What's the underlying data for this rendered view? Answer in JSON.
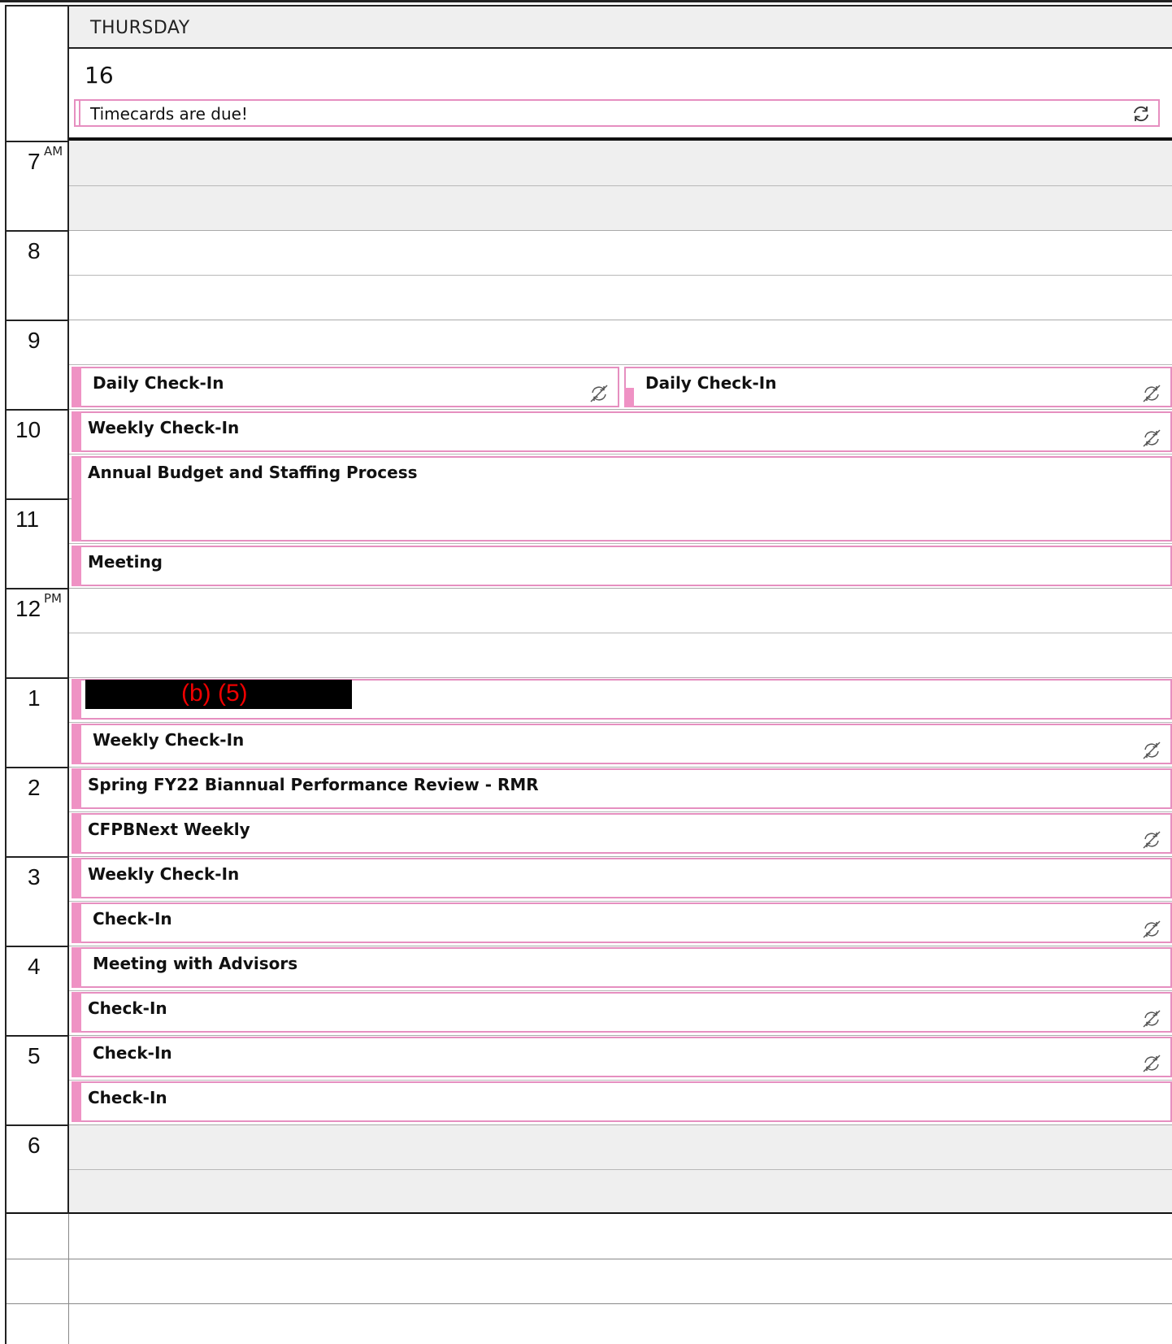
{
  "day": {
    "name": "THURSDAY",
    "number": "16"
  },
  "all_day_event": {
    "title": "Timecards are due!",
    "icon": "sync-icon"
  },
  "time_labels": [
    {
      "hour": "7",
      "suffix": "AM"
    },
    {
      "hour": "8",
      "suffix": ""
    },
    {
      "hour": "9",
      "suffix": ""
    },
    {
      "hour": "10",
      "suffix": ""
    },
    {
      "hour": "11",
      "suffix": ""
    },
    {
      "hour": "12",
      "suffix": "PM"
    },
    {
      "hour": "1",
      "suffix": ""
    },
    {
      "hour": "2",
      "suffix": ""
    },
    {
      "hour": "3",
      "suffix": ""
    },
    {
      "hour": "4",
      "suffix": ""
    },
    {
      "hour": "5",
      "suffix": ""
    },
    {
      "hour": "6",
      "suffix": ""
    }
  ],
  "events": [
    {
      "title": "Daily Check-In",
      "recurring_exception_icon": true
    },
    {
      "title": "Daily Check-In",
      "recurring_exception_icon": true
    },
    {
      "title": "Weekly Check-In",
      "recurring_exception_icon": true
    },
    {
      "title": "Annual Budget and Staffing Process",
      "recurring_exception_icon": false
    },
    {
      "title": "Meeting",
      "recurring_exception_icon": false
    },
    {
      "title": "",
      "recurring_exception_icon": false
    },
    {
      "title": "Weekly Check-In",
      "recurring_exception_icon": true
    },
    {
      "title": "Spring FY22 Biannual Performance Review - RMR",
      "recurring_exception_icon": false
    },
    {
      "title": "CFPBNext Weekly",
      "recurring_exception_icon": true
    },
    {
      "title": "Weekly Check-In",
      "recurring_exception_icon": false
    },
    {
      "title": "Check-In",
      "recurring_exception_icon": true
    },
    {
      "title": "Meeting with Advisors",
      "recurring_exception_icon": false
    },
    {
      "title": "Check-In",
      "recurring_exception_icon": true
    },
    {
      "title": "Check-In",
      "recurring_exception_icon": true
    },
    {
      "title": "Check-In",
      "recurring_exception_icon": false
    }
  ],
  "redaction": {
    "label": "(b) (5)"
  },
  "colors": {
    "event_accent": "#ef92c4",
    "event_border": "#e68fc0",
    "off_hours_bg": "#efefef",
    "redaction_text": "#e00000"
  }
}
